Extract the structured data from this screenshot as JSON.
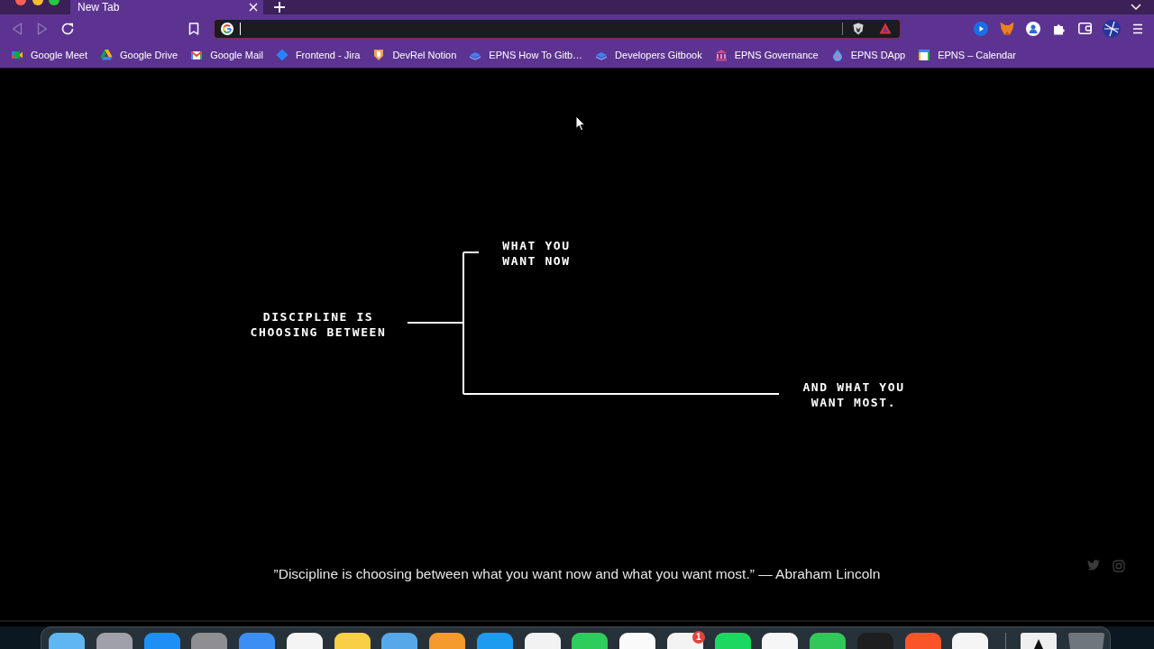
{
  "tabs": [
    {
      "title": "New Tab",
      "selected": true
    }
  ],
  "toolbar": {
    "back": {
      "disabled": true
    },
    "forward": {
      "disabled": true
    }
  },
  "bookmarks": [
    {
      "label": "Google Meet"
    },
    {
      "label": "Google Drive"
    },
    {
      "label": "Google Mail"
    },
    {
      "label": "Frontend - Jira"
    },
    {
      "label": "DevRel Notion"
    },
    {
      "label": "EPNS How To Gitb…"
    },
    {
      "label": "Developers Gitbook"
    },
    {
      "label": "EPNS Governance"
    },
    {
      "label": "EPNS DApp"
    },
    {
      "label": "EPNS – Calendar"
    }
  ],
  "diagram": {
    "root": "DISCIPLINE IS\nCHOOSING BETWEEN",
    "branches": [
      {
        "text": "WHAT YOU\nWANT NOW"
      },
      {
        "text": "AND WHAT YOU\nWANT MOST."
      }
    ]
  },
  "quote": {
    "text": "”Discipline is choosing between what you want now and what you want most.” — Abraham Lincoln"
  },
  "dock": {
    "apps": [
      {
        "color": "#5fb6f2"
      },
      {
        "color": "#a0a0a8"
      },
      {
        "color": "#1e90f5"
      },
      {
        "color": "#8e8e93"
      },
      {
        "color": "#3c8ef5"
      },
      {
        "color": "#f4f4f4"
      },
      {
        "color": "#f7d046"
      },
      {
        "color": "#56a8e8"
      },
      {
        "color": "#f59a2c"
      },
      {
        "color": "#1d9bf0"
      },
      {
        "color": "#f2f2f2"
      },
      {
        "color": "#2ecc5a"
      },
      {
        "color": "#fafafa"
      },
      {
        "color": "#f3f3f3",
        "badge": "1"
      },
      {
        "color": "#1ed760"
      },
      {
        "color": "#f6f6f6"
      },
      {
        "color": "#33c659"
      },
      {
        "color": "#1e1e1e"
      },
      {
        "color": "#fb542b"
      },
      {
        "color": "#f5f5f5"
      }
    ],
    "stacks": [
      {
        "color": "#efefef"
      },
      {
        "color": "#6f767e"
      }
    ]
  }
}
